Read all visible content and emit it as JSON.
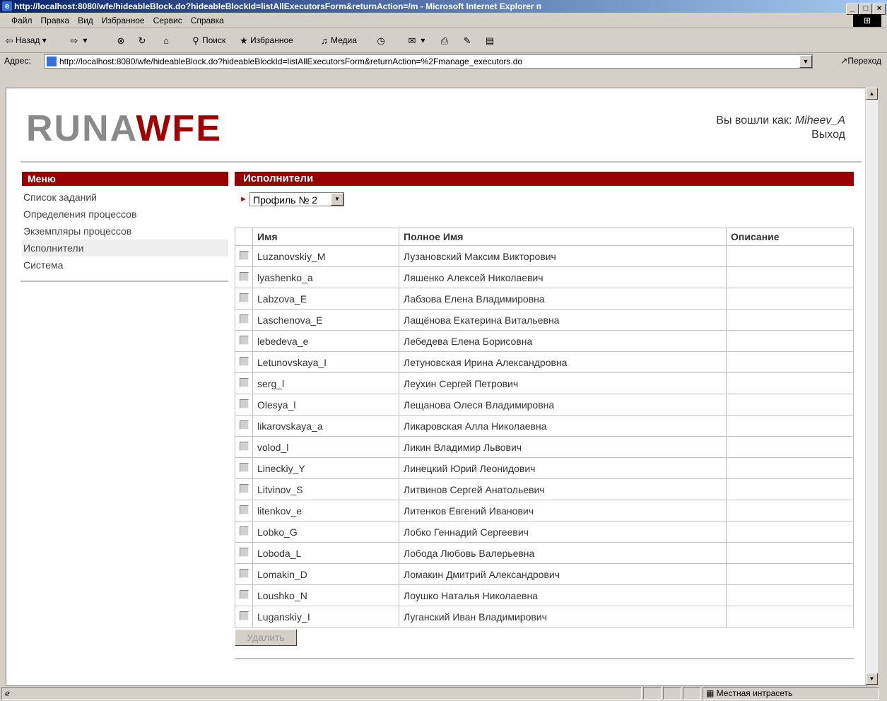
{
  "window": {
    "title": "http://localhost:8080/wfe/hideableBlock.do?hideableBlockId=listAllExecutorsForm&returnAction=/m - Microsoft Internet Explorer п"
  },
  "menubar": [
    "Файл",
    "Правка",
    "Вид",
    "Избранное",
    "Сервис",
    "Справка"
  ],
  "toolbar": {
    "back": "Назад",
    "search": "Поиск",
    "favorites": "Избранное",
    "media": "Медиа"
  },
  "address": {
    "label": "Адрес:",
    "url": "http://localhost:8080/wfe/hideableBlock.do?hideableBlockId=listAllExecutorsForm&returnAction=%2Fmanage_executors.do",
    "go": "Переход"
  },
  "status": {
    "zone": "Местная интрасеть"
  },
  "header": {
    "logo_left": "RUNA",
    "logo_right": "WFE",
    "logged_in_label": "Вы вошли как:",
    "username": "Miheev_A",
    "logout": "Выход"
  },
  "sidebar": {
    "title": "Меню",
    "items": [
      {
        "label": "Список заданий"
      },
      {
        "label": "Определения процессов"
      },
      {
        "label": "Экземпляры процессов"
      },
      {
        "label": "Исполнители"
      },
      {
        "label": "Система"
      }
    ]
  },
  "main": {
    "title": "Исполнители",
    "profile_value": "Профиль № 2",
    "columns": [
      "Имя",
      "Полное Имя",
      "Описание"
    ],
    "rows": [
      {
        "name": "Luzanovskiy_M",
        "full": "Лузановский Максим Викторович",
        "desc": ""
      },
      {
        "name": "lyashenko_a",
        "full": "Ляшенко Алексей Николаевич",
        "desc": ""
      },
      {
        "name": "Labzova_E",
        "full": "Лабзова Елена Владимировна",
        "desc": ""
      },
      {
        "name": "Laschenova_E",
        "full": "Лащёнова Екатерина Витальевна",
        "desc": ""
      },
      {
        "name": "lebedeva_e",
        "full": "Лебедева Елена Борисовна",
        "desc": ""
      },
      {
        "name": "Letunovskaya_I",
        "full": "Летуновская Ирина Александровна",
        "desc": ""
      },
      {
        "name": "serg_l",
        "full": "Леухин Сергей Петрович",
        "desc": ""
      },
      {
        "name": "Olesya_l",
        "full": "Лещанова Олеся Владимировна",
        "desc": ""
      },
      {
        "name": "likarovskaya_a",
        "full": "Ликаровская Алла Николаевна",
        "desc": ""
      },
      {
        "name": "volod_l",
        "full": "Ликин Владимир Львович",
        "desc": ""
      },
      {
        "name": "Lineckiy_Y",
        "full": "Линецкий Юрий Леонидович",
        "desc": ""
      },
      {
        "name": "Litvinov_S",
        "full": "Литвинов Сергей Анатольевич",
        "desc": ""
      },
      {
        "name": "litenkov_e",
        "full": "Литенков Евгений Иванович",
        "desc": ""
      },
      {
        "name": "Lobko_G",
        "full": "Лобко Геннадий Сергеевич",
        "desc": ""
      },
      {
        "name": "Loboda_L",
        "full": "Лобода Любовь Валерьевна",
        "desc": ""
      },
      {
        "name": "Lomakin_D",
        "full": "Ломакин Дмитрий Александрович",
        "desc": ""
      },
      {
        "name": "Loushko_N",
        "full": "Лоушко Наталья Николаевна",
        "desc": ""
      },
      {
        "name": "Luganskiy_I",
        "full": "Луганский Иван Владимирович",
        "desc": ""
      }
    ],
    "delete_label": "Удалить"
  }
}
